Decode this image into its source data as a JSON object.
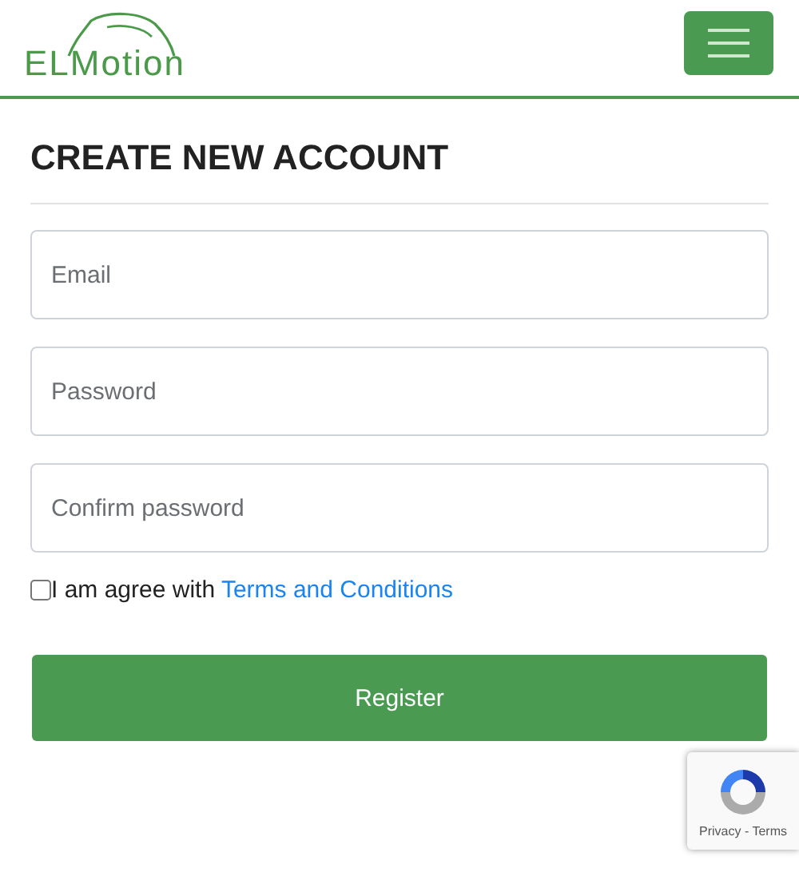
{
  "header": {
    "logo": "ELMotion"
  },
  "form": {
    "title": "CREATE NEW ACCOUNT",
    "fields": [
      {
        "placeholder": "Email"
      },
      {
        "placeholder": "Password"
      },
      {
        "placeholder": "Confirm password"
      }
    ],
    "agree": {
      "checked": false,
      "text": "I am agree with ",
      "link": "Terms and Conditions"
    },
    "submit": "Register"
  },
  "recaptcha": {
    "links": "Privacy - Terms"
  }
}
